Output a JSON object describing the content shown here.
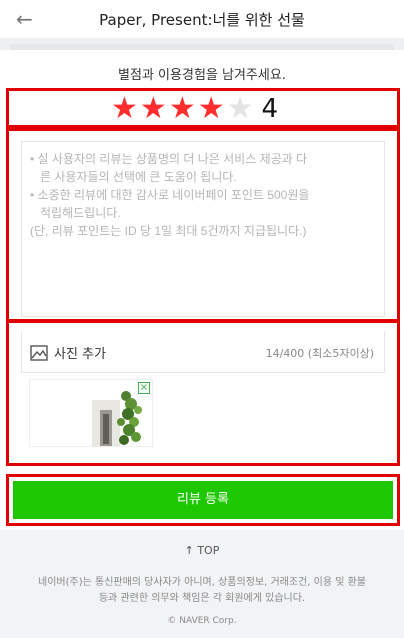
{
  "header": {
    "back_glyph": "←",
    "title": "Paper, Present:너를 위한 선물"
  },
  "prompt": "별점과 이용경험을 남겨주세요.",
  "rating": {
    "value": 4,
    "max": 5,
    "display": "4",
    "star_color": "#ff2d2d",
    "empty_star_color": "#e4e4e4"
  },
  "review_input": {
    "placeholder_lines": [
      "• 실 사용자의 리뷰는 상품명의 더 나은 서비스 제공과 다",
      "른 사용자들의 선택에 큰 도움이 됩니다.",
      "• 소중한 리뷰에 대한 감사로 네이버페이 포인트 500원을",
      "적립해드립니다.",
      "(단, 리뷰 포인트는 ID 당 1일 최대 5건까지 지급됩니다.)"
    ],
    "value": ""
  },
  "photo": {
    "add_label": "사진 추가",
    "count_text": "14/400 (최소5자이상)",
    "remove_glyph": "×"
  },
  "submit": {
    "label": "리뷰 등록",
    "color": "#1ec800"
  },
  "footer": {
    "top_link": "↑ TOP",
    "disclaimer_lines": [
      "네이버(주)는 통신판매의 당사자가 아니며, 상품의정보, 거래조건, 이용 및 환불",
      "등과 관련한 의무와 책임은 각 회원에게 있습니다."
    ],
    "copyright": "© NAVER Corp."
  },
  "highlight_color": "#e00000"
}
